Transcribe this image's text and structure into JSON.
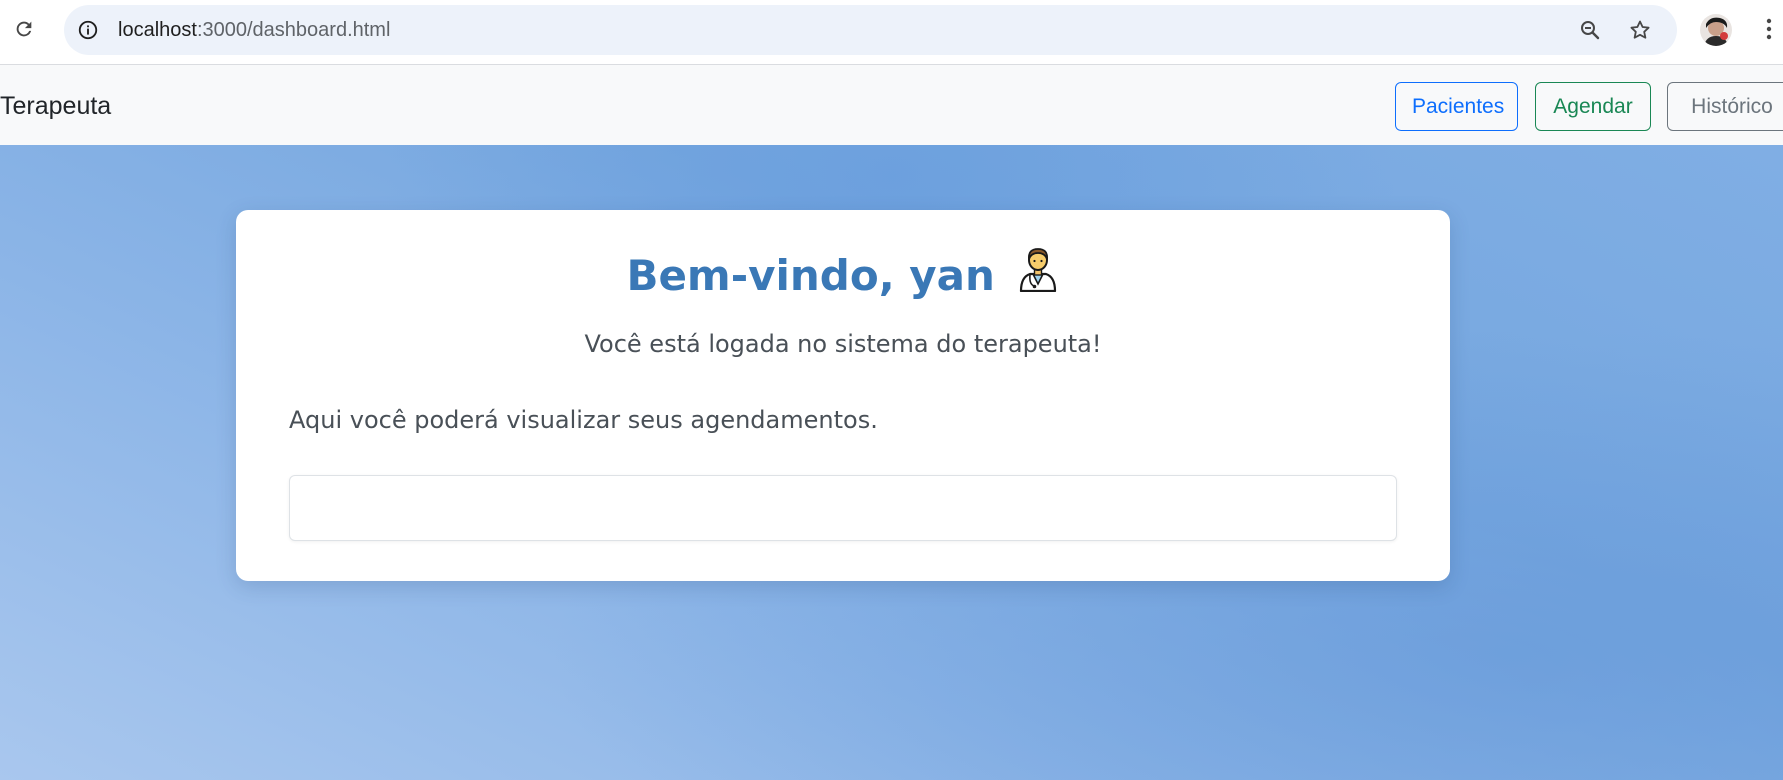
{
  "browser": {
    "url_host": "localhost",
    "url_path": ":3000/dashboard.html",
    "icons": {
      "reload": "reload-icon",
      "site_info": "info-icon",
      "zoom": "zoom-out-icon",
      "bookmark": "star-icon",
      "menu": "kebab-menu-icon",
      "profile": "profile-avatar"
    }
  },
  "navbar": {
    "brand": "Terapeuta",
    "buttons": {
      "pacientes": "Pacientes",
      "agendar": "Agendar",
      "historico": "Histórico"
    },
    "colors": {
      "primary": "#0d6efd",
      "success": "#198754",
      "secondary": "#6c757d"
    }
  },
  "main": {
    "title": "Bem-vindo, yan",
    "title_icon": "health-worker-icon",
    "subtitle": "Você está logada no sistema do terapeuta!",
    "info": "Aqui você poderá visualizar seus agendamentos.",
    "appointments": [],
    "colors": {
      "title": "#3a78b6",
      "background": "#7aaae0"
    }
  }
}
